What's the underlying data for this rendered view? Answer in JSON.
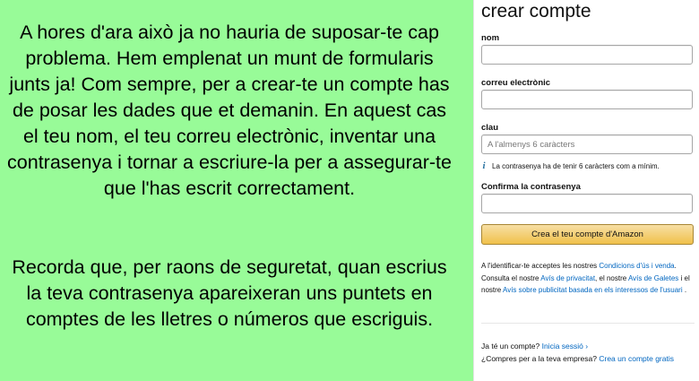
{
  "instructions": {
    "paragraph_1": "A hores d'ara això ja no hauria de suposar-te cap problema. Hem emplenat un munt de formularis junts ja! Com sempre, per a crear-te un compte has de posar les dades que et demanin. En aquest cas el teu nom, el teu correu electrònic, inventar una contrasenya i tornar a escriure-la per a assegurar-te que l'has escrit correctament.",
    "paragraph_2": "Recorda que, per raons de seguretat, quan escrius la teva contrasenya apareixeran uns puntets en comptes de les lletres o números que escriguis."
  },
  "form": {
    "title": "crear compte",
    "name_label": "nom",
    "name_value": "",
    "email_label": "correu electrònic",
    "email_value": "",
    "password_label": "clau",
    "password_placeholder": "A l'almenys 6 caràcters",
    "password_hint_icon": "info-icon",
    "password_hint": "La contrasenya ha de tenir 6 caràcters com a mínim.",
    "confirm_label": "Confirma la contrasenya",
    "confirm_value": "",
    "submit_label": "Crea el teu compte d'Amazon"
  },
  "legal": {
    "text_1": "A l'identificar-te acceptes les nostres ",
    "link_conditions": "Condicions d'ús i venda",
    "text_2": ". Consulta el nostre ",
    "link_privacy": "Avís de privacitat",
    "text_3": ", el nostre ",
    "link_cookies": "Avís de Galetes",
    "text_4": " i el nostre ",
    "link_ads": "Avís sobre publicitat basada en els interessos de l'usuari",
    "text_5": " ."
  },
  "footer": {
    "have_account_text": "Ja té un compte?",
    "signin_link": "Inicia sessió",
    "signin_arrow": "›",
    "business_text": "¿Compres per a la teva empresa?",
    "business_link": "Crea un compte gratis"
  },
  "colors": {
    "background": "#98fb98",
    "link": "#0066c0",
    "button_top": "#f7dfa5",
    "button_bottom": "#f0c14b",
    "info_icon": "#2a72a0"
  }
}
